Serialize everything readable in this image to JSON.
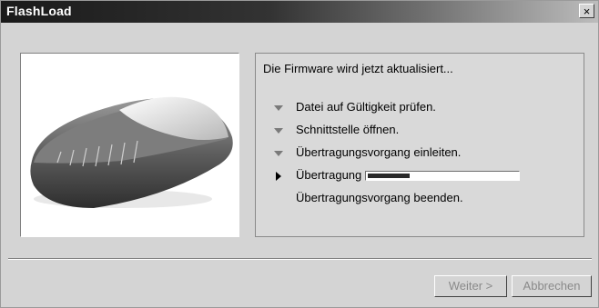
{
  "window": {
    "title": "FlashLoad",
    "close_symbol": "×"
  },
  "status": {
    "header": "Die Firmware wird jetzt aktualisiert...",
    "steps": [
      {
        "label": "Datei auf Gültigkeit prüfen.",
        "state": "done",
        "icon": "triangle-down-icon"
      },
      {
        "label": "Schnittstelle öffnen.",
        "state": "done",
        "icon": "triangle-down-icon"
      },
      {
        "label": "Übertragungsvorgang einleiten.",
        "state": "done",
        "icon": "triangle-down-icon"
      },
      {
        "label": "Übertragung",
        "state": "active",
        "icon": "triangle-right-icon",
        "progress": 0.28
      },
      {
        "label": "Übertragungsvorgang beenden.",
        "state": "pending",
        "icon": ""
      }
    ]
  },
  "buttons": {
    "next_label": "Weiter >",
    "cancel_label": "Abbrechen"
  },
  "colors": {
    "titlebar": "#1a1a1a",
    "dialog_bg": "#d4d4d4",
    "progress_fill": "#2a2a2a"
  }
}
